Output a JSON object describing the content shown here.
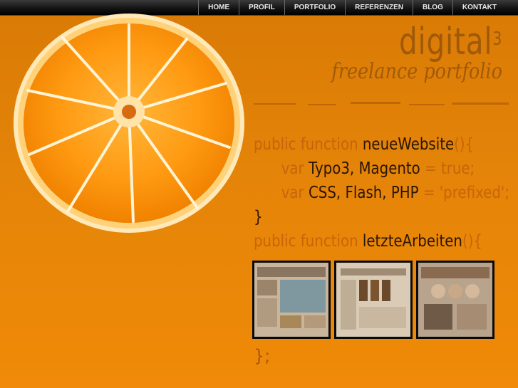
{
  "nav": {
    "items": [
      {
        "label": "HOME"
      },
      {
        "label": "PROFIL"
      },
      {
        "label": "PORTFOLIO"
      },
      {
        "label": "REFERENZEN"
      },
      {
        "label": "BLOG"
      },
      {
        "label": "KONTAKT"
      }
    ]
  },
  "logo": {
    "main": "digital",
    "sup": "3",
    "sub": "freelance portfolio"
  },
  "code": {
    "line1_kw_a": "public function ",
    "line1_id": "neueWebsite",
    "line1_kw_b": "(){",
    "line2_kw_a": "var ",
    "line2_id": "Typo3, Magento",
    "line2_kw_b": " = true;",
    "line3_kw_a": "var ",
    "line3_id": "CSS, Flash, PHP",
    "line3_kw_b": " = 'prefixed';",
    "line4_id": "}",
    "line5_kw_a": "public function ",
    "line5_id": "letzteArbeiten",
    "line5_kw_b": "(){",
    "closing": "};"
  },
  "thumbnails": [
    {
      "name": "portfolio-thumb-1"
    },
    {
      "name": "portfolio-thumb-2"
    },
    {
      "name": "portfolio-thumb-3"
    }
  ],
  "colors": {
    "background": "#e48408",
    "nav_bg": "#111111",
    "code_keyword": "#be5a0a",
    "code_identifier": "#2a1500",
    "thumb_border": "#0a0a0a"
  }
}
